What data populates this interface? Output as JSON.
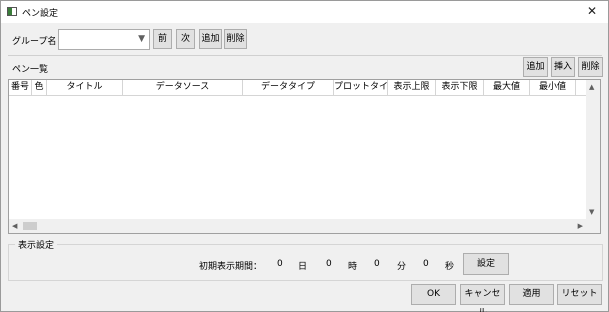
{
  "window": {
    "title": "ペン設定",
    "close_glyph": "✕"
  },
  "group": {
    "label": "グループ名",
    "combo_value": "",
    "combo_arrow": "▼",
    "prev_label": "前",
    "next_label": "次",
    "add_label": "追加",
    "delete_label": "削除"
  },
  "pen_list": {
    "label": "ペン一覧",
    "add_label": "追加",
    "insert_label": "挿入",
    "delete_label": "削除",
    "columns": [
      "番号",
      "色",
      "タイトル",
      "データソース",
      "データタイプ",
      "プロットタイプ",
      "表示上限",
      "表示下限",
      "最大値",
      "最小値"
    ],
    "rows": []
  },
  "display_settings": {
    "group_title": "表示設定",
    "period_label": "初期表示期間：",
    "days_value": "0",
    "days_unit": "日",
    "hours_value": "0",
    "hours_unit": "時",
    "minutes_value": "0",
    "minutes_unit": "分",
    "seconds_value": "0",
    "seconds_unit": "秒",
    "set_label": "設定"
  },
  "footer": {
    "ok_label": "OK",
    "cancel_label": "キャンセル",
    "apply_label": "適用",
    "reset_label": "リセット"
  },
  "scroll": {
    "up": "▲",
    "down": "▼",
    "left": "◀",
    "right": "▶"
  }
}
